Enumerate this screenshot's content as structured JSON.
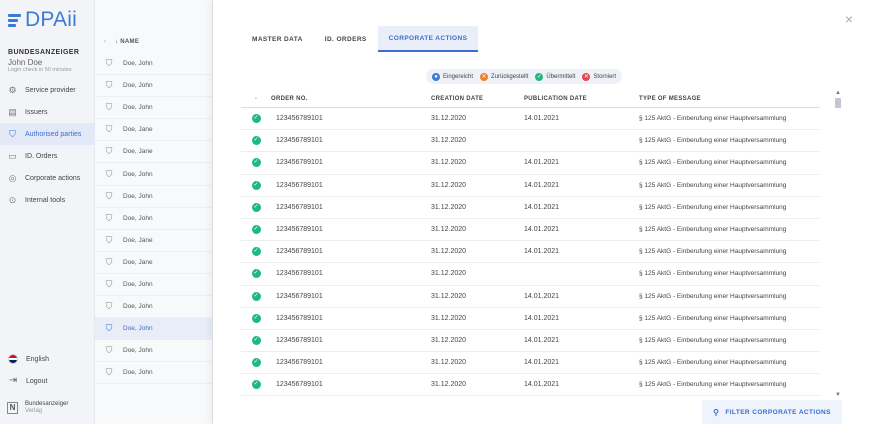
{
  "app": {
    "logo_text": "DPAii",
    "org": "BUNDESANZEIGER",
    "user": "John Doe",
    "login_check": "Login check in 50 minutes"
  },
  "nav": [
    {
      "label": "Service provider",
      "icon": "service-provider-icon",
      "active": false
    },
    {
      "label": "Issuers",
      "icon": "issuers-icon",
      "active": false
    },
    {
      "label": "Authorised parties",
      "icon": "authorised-parties-icon",
      "active": true
    },
    {
      "label": "ID. Orders",
      "icon": "folder-icon",
      "active": false
    },
    {
      "label": "Corporate actions",
      "icon": "corporate-actions-icon",
      "active": false
    },
    {
      "label": "Internal tools",
      "icon": "internal-tools-icon",
      "active": false
    }
  ],
  "bottom": {
    "language": "English",
    "logout": "Logout",
    "verlag_line1": "Bundesanzeiger",
    "verlag_line2": "Verlag"
  },
  "list": {
    "dash": "-",
    "header": "↓ NAME",
    "rows": [
      {
        "name": "Doe, John",
        "active": false
      },
      {
        "name": "Doe, John",
        "active": false
      },
      {
        "name": "Doe, John",
        "active": false
      },
      {
        "name": "Doe, Jane",
        "active": false
      },
      {
        "name": "Doe, Jane",
        "active": false
      },
      {
        "name": "Doe, John",
        "active": false
      },
      {
        "name": "Doe, John",
        "active": false
      },
      {
        "name": "Doe, John",
        "active": false
      },
      {
        "name": "Doe, Jane",
        "active": false
      },
      {
        "name": "Doe, Jane",
        "active": false
      },
      {
        "name": "Doe, John",
        "active": false
      },
      {
        "name": "Doe, John",
        "active": false
      },
      {
        "name": "Doe, John",
        "active": true
      },
      {
        "name": "Doe, John",
        "active": false
      },
      {
        "name": "Doe, John",
        "active": false
      }
    ]
  },
  "panel": {
    "close": "×",
    "tabs": [
      {
        "label": "MASTER DATA",
        "active": false
      },
      {
        "label": "ID. ORDERS",
        "active": false
      },
      {
        "label": "CORPORATE ACTIONS",
        "active": true
      }
    ],
    "legend": [
      {
        "label": "Eingereicht",
        "color": "#3a7bd5",
        "glyph": "●"
      },
      {
        "label": "Zurückgestellt",
        "color": "#f07f2c",
        "glyph": "✕"
      },
      {
        "label": "Übermittelt",
        "color": "#1eb980",
        "glyph": "✓"
      },
      {
        "label": "Storniert",
        "color": "#e5484d",
        "glyph": "✕"
      }
    ],
    "table": {
      "columns": [
        "-",
        "ORDER NO.",
        "CREATION DATE",
        "PUBLICATION DATE",
        "TYPE OF MESSAGE"
      ],
      "rows": [
        {
          "order": "123456789101",
          "created": "31.12.2020",
          "published": "14.01.2021",
          "type": "§ 125 AktG - Einberufung einer Hauptversammlung"
        },
        {
          "order": "123456789101",
          "created": "31.12.2020",
          "published": "",
          "type": "§ 125 AktG - Einberufung einer Hauptversammlung"
        },
        {
          "order": "123456789101",
          "created": "31.12.2020",
          "published": "14.01.2021",
          "type": "§ 125 AktG - Einberufung einer Hauptversammlung"
        },
        {
          "order": "123456789101",
          "created": "31.12.2020",
          "published": "14.01.2021",
          "type": "§ 125 AktG - Einberufung einer Hauptversammlung"
        },
        {
          "order": "123456789101",
          "created": "31.12.2020",
          "published": "14.01.2021",
          "type": "§ 125 AktG - Einberufung einer Hauptversammlung"
        },
        {
          "order": "123456789101",
          "created": "31.12.2020",
          "published": "14.01.2021",
          "type": "§ 125 AktG - Einberufung einer Hauptversammlung"
        },
        {
          "order": "123456789101",
          "created": "31.12.2020",
          "published": "14.01.2021",
          "type": "§ 125 AktG - Einberufung einer Hauptversammlung"
        },
        {
          "order": "123456789101",
          "created": "31.12.2020",
          "published": "",
          "type": "§ 125 AktG - Einberufung einer Hauptversammlung"
        },
        {
          "order": "123456789101",
          "created": "31.12.2020",
          "published": "14.01.2021",
          "type": "§ 125 AktG - Einberufung einer Hauptversammlung"
        },
        {
          "order": "123456789101",
          "created": "31.12.2020",
          "published": "14.01.2021",
          "type": "§ 125 AktG - Einberufung einer Hauptversammlung"
        },
        {
          "order": "123456789101",
          "created": "31.12.2020",
          "published": "14.01.2021",
          "type": "§ 125 AktG - Einberufung einer Hauptversammlung"
        },
        {
          "order": "123456789101",
          "created": "31.12.2020",
          "published": "14.01.2021",
          "type": "§ 125 AktG - Einberufung einer Hauptversammlung"
        },
        {
          "order": "123456789101",
          "created": "31.12.2020",
          "published": "14.01.2021",
          "type": "§ 125 AktG - Einberufung einer Hauptversammlung"
        }
      ]
    },
    "filter_button": "FILTER CORPORATE ACTIONS"
  }
}
